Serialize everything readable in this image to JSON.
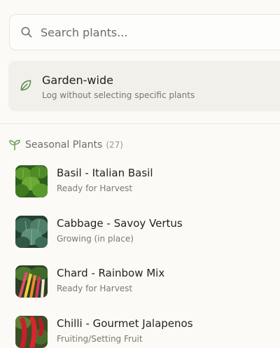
{
  "search": {
    "placeholder": "Search plants...",
    "value": ""
  },
  "garden_wide": {
    "title": "Garden-wide",
    "subtitle": "Log without selecting specific plants"
  },
  "section": {
    "title": "Seasonal Plants",
    "count": "(27)"
  },
  "plants": [
    {
      "name": "Basil - Italian Basil",
      "status": "Ready for Harvest",
      "thumb_icon": "basil-photo"
    },
    {
      "name": "Cabbage - Savoy Vertus",
      "status": "Growing (in place)",
      "thumb_icon": "cabbage-photo"
    },
    {
      "name": "Chard - Rainbow Mix",
      "status": "Ready for Harvest",
      "thumb_icon": "chard-photo"
    },
    {
      "name": "Chilli - Gourmet Jalapenos",
      "status": "Fruiting/Setting Fruit",
      "thumb_icon": "chilli-photo"
    }
  ],
  "colors": {
    "accent_green": "#5f8a52",
    "background": "#fbfaf6",
    "card": "#f1f0ea"
  }
}
